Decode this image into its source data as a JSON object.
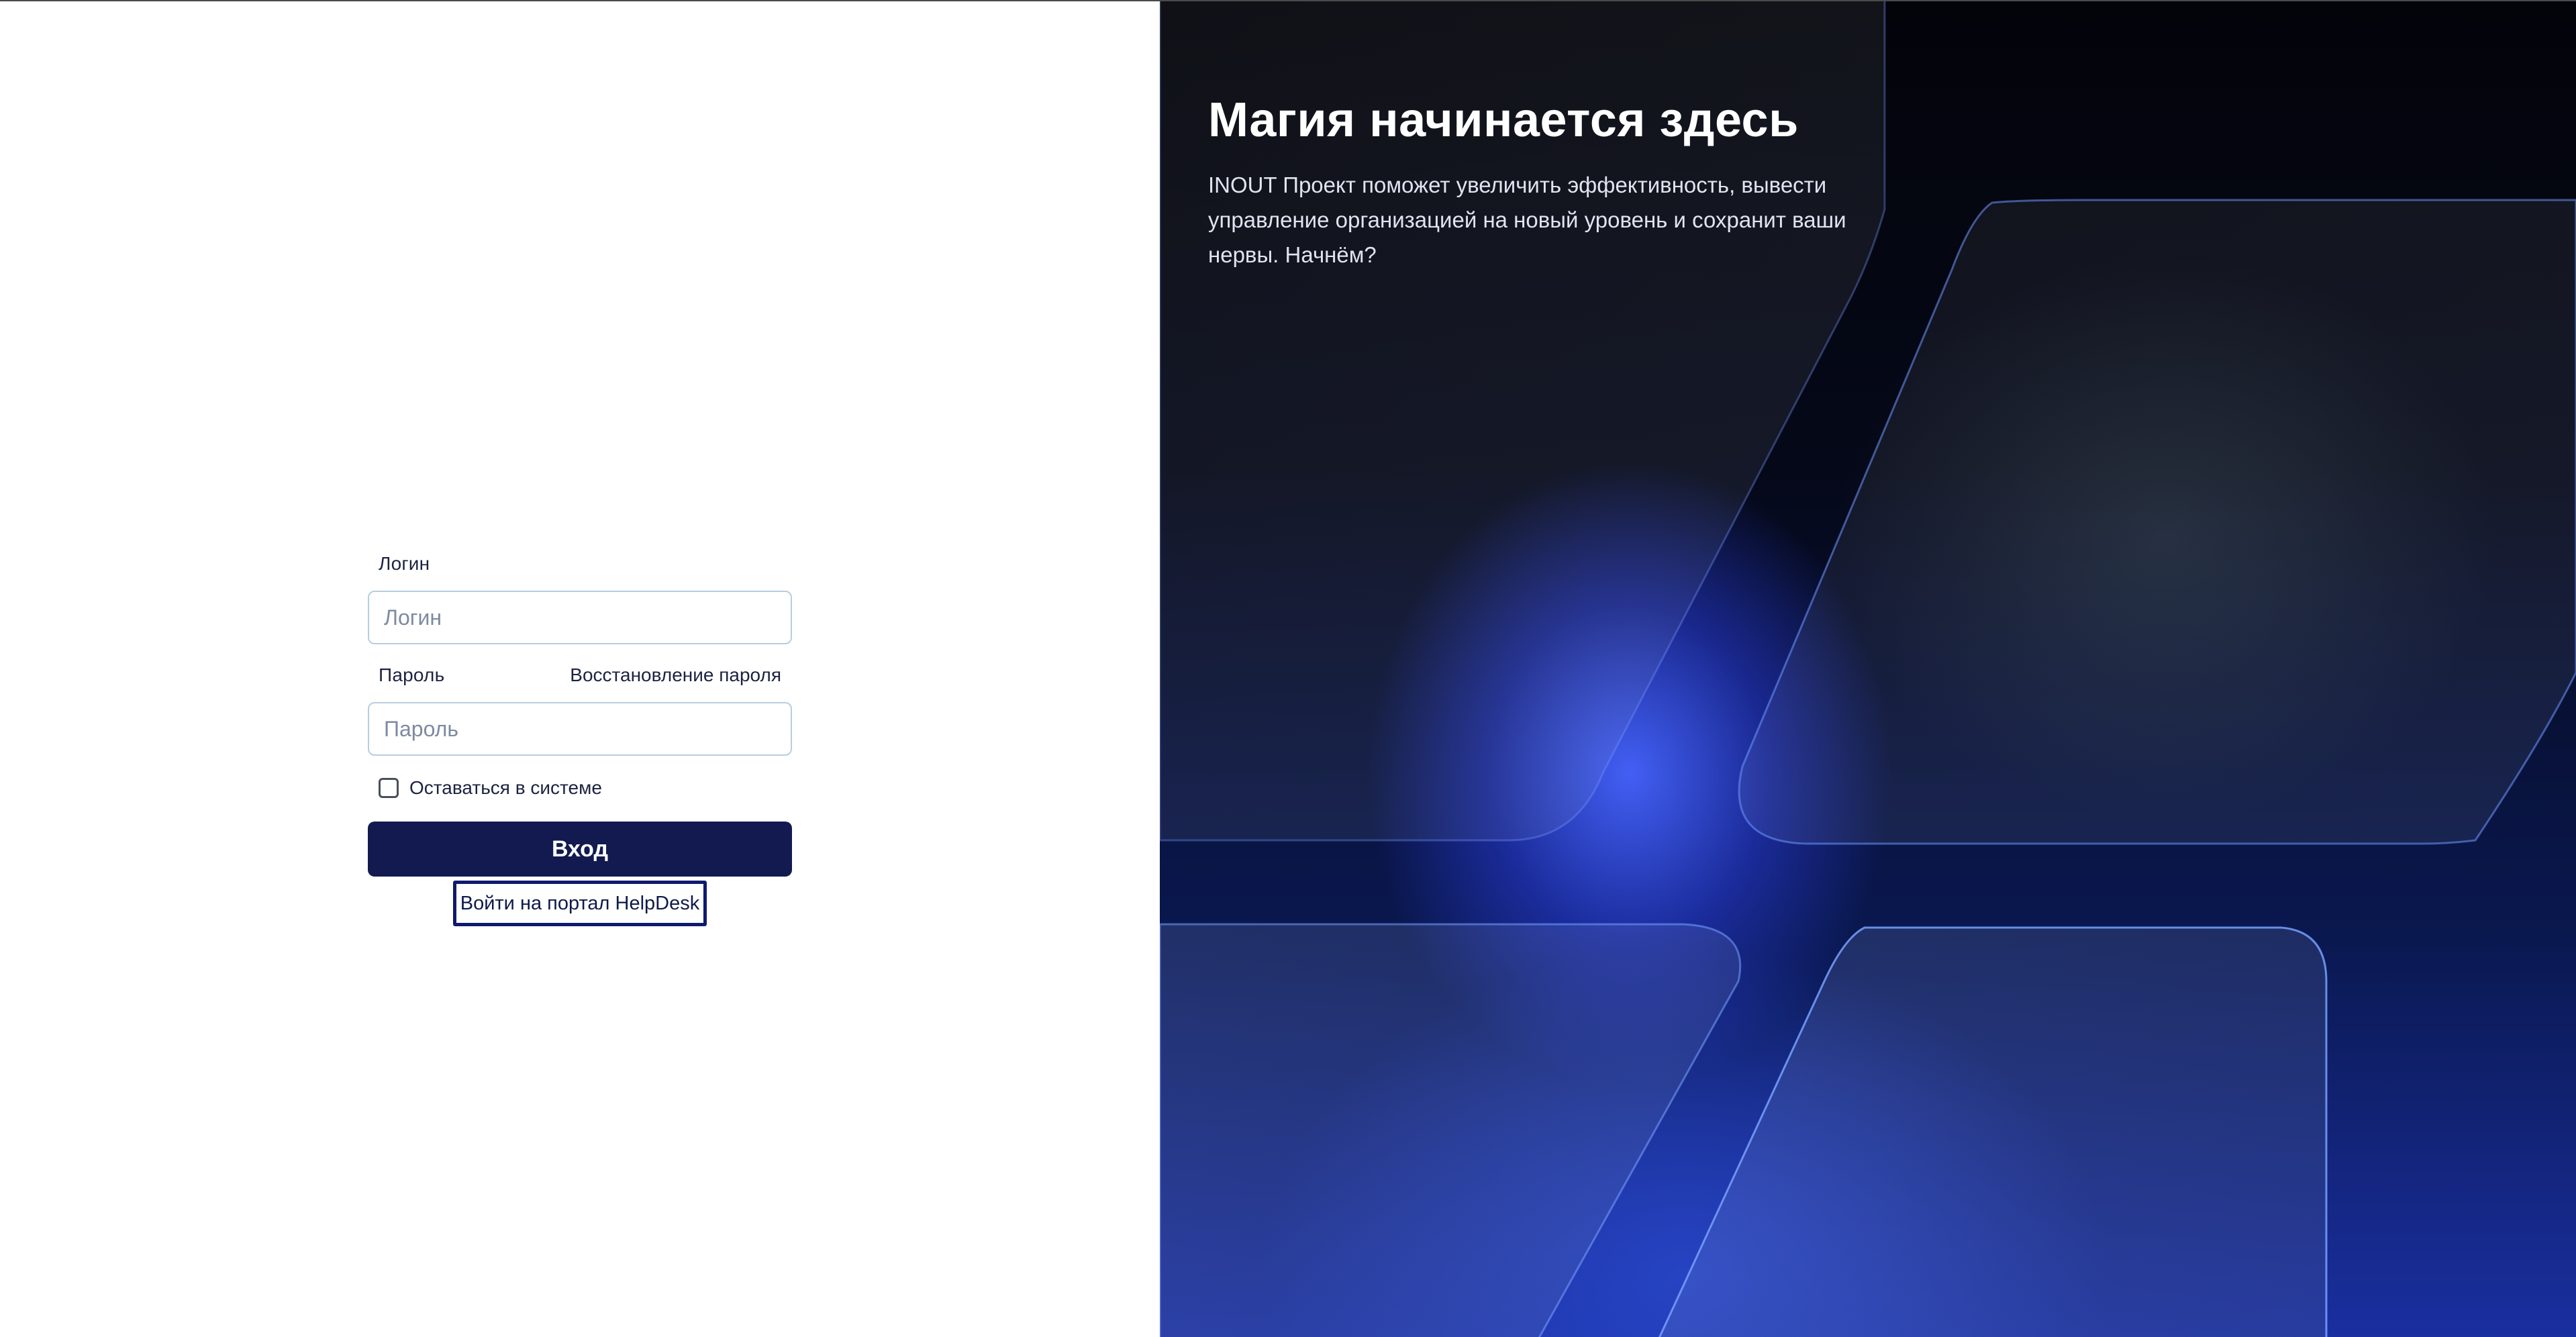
{
  "login_form": {
    "login_label": "Логин",
    "login_placeholder": "Логин",
    "login_value": "",
    "password_label": "Пароль",
    "password_placeholder": "Пароль",
    "password_value": "",
    "recover_password_link": "Восстановление пароля",
    "remember_me_label": "Оставаться в системе",
    "remember_me_checked": false,
    "submit_label": "Вход",
    "helpdesk_link": "Войти на портал HelpDesk"
  },
  "hero": {
    "title": "Магия начинается здесь",
    "description": "INOUT Проект поможет увеличить эффективность, вывести управление организацией на новый уровень и сохранит ваши нервы. Начнём?"
  },
  "colors": {
    "primary_button": "#121a50",
    "input_border": "#b8cde0",
    "link_outline": "#0f1a6e",
    "hero_background": "#03040a",
    "hero_glow": "#4664ff"
  }
}
